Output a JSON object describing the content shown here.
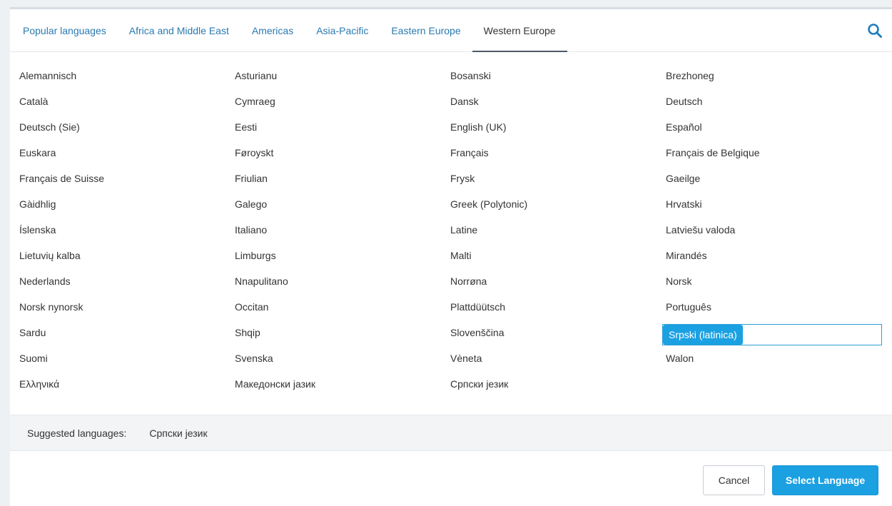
{
  "tabs": [
    {
      "label": "Popular languages",
      "active": false
    },
    {
      "label": "Africa and Middle East",
      "active": false
    },
    {
      "label": "Americas",
      "active": false
    },
    {
      "label": "Asia-Pacific",
      "active": false
    },
    {
      "label": "Eastern Europe",
      "active": false
    },
    {
      "label": "Western Europe",
      "active": true
    }
  ],
  "search": {
    "icon": "search-icon"
  },
  "columns": [
    [
      "Alemannisch",
      "Català",
      "Deutsch (Sie)",
      "Euskara",
      "Français de Suisse",
      "Gàidhlig",
      "Íslenska",
      "Lietuvių kalba",
      "Nederlands",
      "Norsk nynorsk",
      "Sardu",
      "Suomi",
      "Ελληνικά"
    ],
    [
      "Asturianu",
      "Cymraeg",
      "Eesti",
      "Føroyskt",
      "Friulian",
      "Galego",
      "Italiano",
      "Limburgs",
      "Nnapulitano",
      "Occitan",
      "Shqip",
      "Svenska",
      "Македонски јазик"
    ],
    [
      "Bosanski",
      "Dansk",
      "English (UK)",
      "Français",
      "Frysk",
      "Greek (Polytonic)",
      "Latine",
      "Malti",
      "Norrøna",
      "Plattdüütsch",
      "Slovenščina",
      "Vèneta",
      "Српски језик"
    ],
    [
      "Brezhoneg",
      "Deutsch",
      "Español",
      "Français de Belgique",
      "Gaeilge",
      "Hrvatski",
      "Latviešu valoda",
      "Mirandés",
      "Norsk",
      "Português",
      "Srpski (latinica)",
      "Walon"
    ]
  ],
  "selected_language": "Srpski (latinica)",
  "suggested": {
    "label": "Suggested languages:",
    "items": [
      "Српски језик"
    ]
  },
  "footer": {
    "cancel_label": "Cancel",
    "select_label": "Select Language"
  },
  "colors": {
    "accent": "#1ba1e2",
    "tab_link": "#2a7ab0",
    "text": "#333333"
  }
}
